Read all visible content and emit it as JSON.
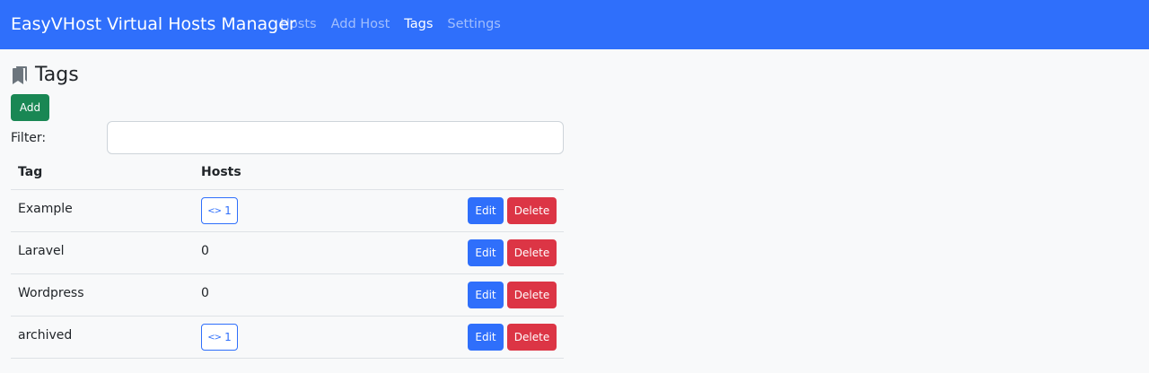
{
  "navbar": {
    "brand": "EasyVHost Virtual Hosts Manager",
    "links": [
      {
        "label": "Hosts",
        "active": false
      },
      {
        "label": "Add Host",
        "active": false
      },
      {
        "label": "Tags",
        "active": true
      },
      {
        "label": "Settings",
        "active": false
      }
    ],
    "color": "#2f6ffb"
  },
  "page": {
    "title": "Tags",
    "title_icon": "bookmark-icon"
  },
  "toolbar": {
    "add_label": "Add",
    "filter_label": "Filter:",
    "filter_value": "",
    "filter_placeholder": ""
  },
  "table": {
    "headers": [
      "Tag",
      "Hosts"
    ],
    "rows": [
      {
        "tag": "Example",
        "hosts": "1",
        "hosts_link": true
      },
      {
        "tag": "Laravel",
        "hosts": "0",
        "hosts_link": false
      },
      {
        "tag": "Wordpress",
        "hosts": "0",
        "hosts_link": false
      },
      {
        "tag": "archived",
        "hosts": "1",
        "hosts_link": true
      }
    ],
    "edit_label": "Edit",
    "delete_label": "Delete",
    "host_badge_icon": "code-icon"
  },
  "colors": {
    "primary": "#2f6ffb",
    "success": "#198754",
    "danger": "#dc3545"
  }
}
